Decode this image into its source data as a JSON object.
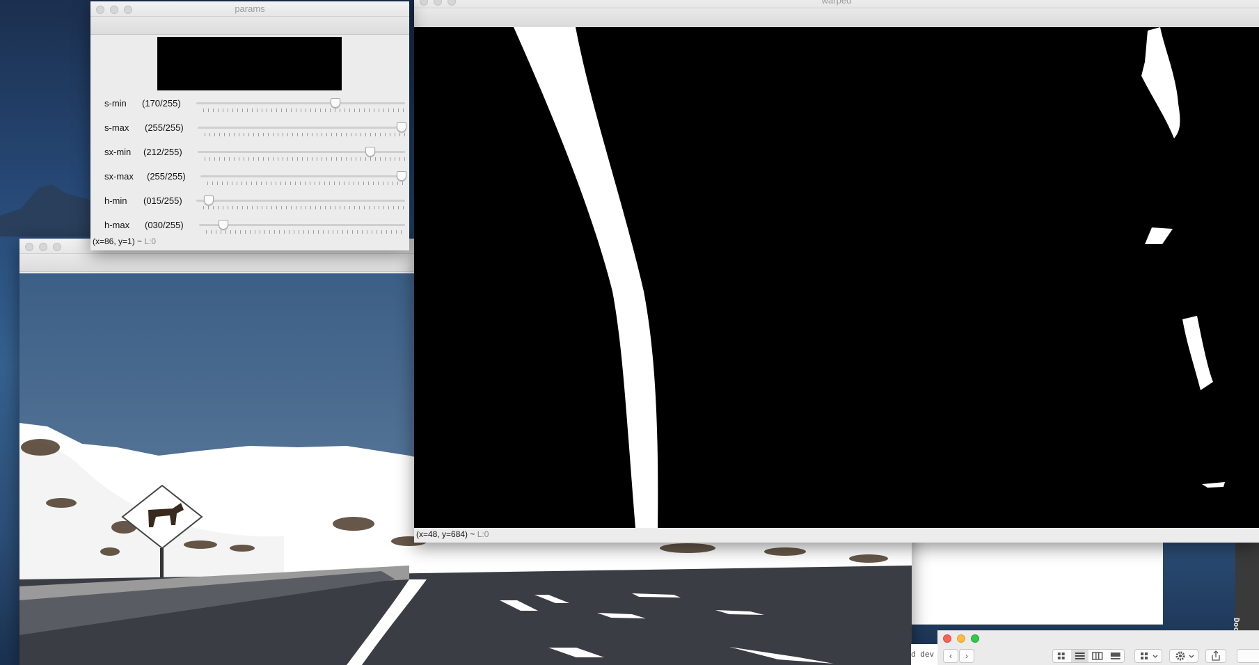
{
  "params_window": {
    "title": "params",
    "sliders": [
      {
        "name": "s-min",
        "value": "(170/255)",
        "level": 0.667
      },
      {
        "name": "s-max",
        "value": "(255/255)",
        "level": 1.0
      },
      {
        "name": "sx-min",
        "value": "(212/255)",
        "level": 0.831
      },
      {
        "name": "sx-max",
        "value": "(255/255)",
        "level": 1.0
      },
      {
        "name": "h-min",
        "value": "(015/255)",
        "level": 0.059
      },
      {
        "name": "h-max",
        "value": "(030/255)",
        "level": 0.118
      }
    ],
    "status": {
      "coords": "(x=86, y=1) ~",
      "level": "L:0"
    }
  },
  "warped_window": {
    "title": "warped",
    "status": {
      "coords": "(x=48, y=684) ~",
      "level": "L:0"
    }
  },
  "original_window": {
    "title": ""
  },
  "documentation_tab": {
    "label": "Documentation"
  },
  "terminal_fragment": {
    "text": "d dev"
  },
  "finder": {
    "back_glyph": "‹",
    "forward_glyph": "›",
    "view_icons": [
      "icon-view-icon",
      "list-view-icon",
      "column-view-icon",
      "gallery-view-icon"
    ],
    "group_icon": "grid-group-icon",
    "action_icon": "gear-icon",
    "share_icon": "share-icon"
  },
  "colors": {
    "traffic_red": "#fc605c",
    "traffic_yellow": "#fdbc40",
    "traffic_green": "#34c84a",
    "sky": "#4f6f96",
    "road": "#3a3d44"
  }
}
